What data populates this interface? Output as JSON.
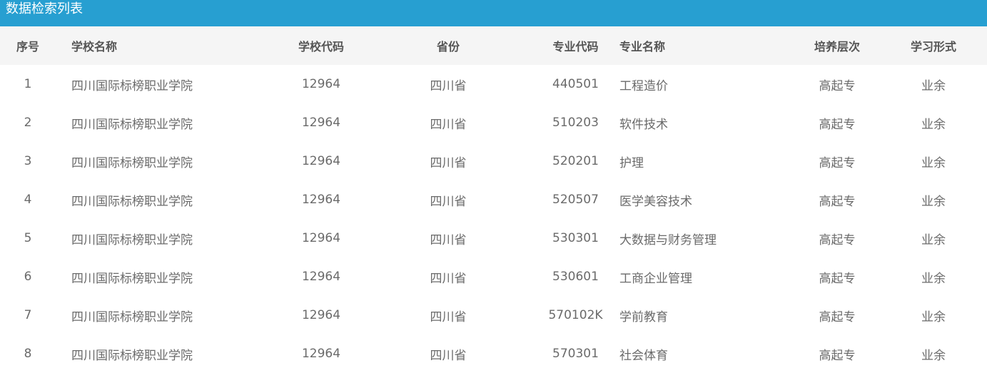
{
  "title": "数据检索列表",
  "columns": {
    "index": "序号",
    "school_name": "学校名称",
    "school_code": "学校代码",
    "province": "省份",
    "major_code": "专业代码",
    "major_name": "专业名称",
    "level": "培养层次",
    "study_form": "学习形式"
  },
  "rows": [
    {
      "index": "1",
      "school_name": "四川国际标榜职业学院",
      "school_code": "12964",
      "province": "四川省",
      "major_code": "440501",
      "major_name": "工程造价",
      "level": "高起专",
      "study_form": "业余"
    },
    {
      "index": "2",
      "school_name": "四川国际标榜职业学院",
      "school_code": "12964",
      "province": "四川省",
      "major_code": "510203",
      "major_name": "软件技术",
      "level": "高起专",
      "study_form": "业余"
    },
    {
      "index": "3",
      "school_name": "四川国际标榜职业学院",
      "school_code": "12964",
      "province": "四川省",
      "major_code": "520201",
      "major_name": "护理",
      "level": "高起专",
      "study_form": "业余"
    },
    {
      "index": "4",
      "school_name": "四川国际标榜职业学院",
      "school_code": "12964",
      "province": "四川省",
      "major_code": "520507",
      "major_name": "医学美容技术",
      "level": "高起专",
      "study_form": "业余"
    },
    {
      "index": "5",
      "school_name": "四川国际标榜职业学院",
      "school_code": "12964",
      "province": "四川省",
      "major_code": "530301",
      "major_name": "大数据与财务管理",
      "level": "高起专",
      "study_form": "业余"
    },
    {
      "index": "6",
      "school_name": "四川国际标榜职业学院",
      "school_code": "12964",
      "province": "四川省",
      "major_code": "530601",
      "major_name": "工商企业管理",
      "level": "高起专",
      "study_form": "业余"
    },
    {
      "index": "7",
      "school_name": "四川国际标榜职业学院",
      "school_code": "12964",
      "province": "四川省",
      "major_code": "570102K",
      "major_name": "学前教育",
      "level": "高起专",
      "study_form": "业余"
    },
    {
      "index": "8",
      "school_name": "四川国际标榜职业学院",
      "school_code": "12964",
      "province": "四川省",
      "major_code": "570301",
      "major_name": "社会体育",
      "level": "高起专",
      "study_form": "业余"
    }
  ]
}
